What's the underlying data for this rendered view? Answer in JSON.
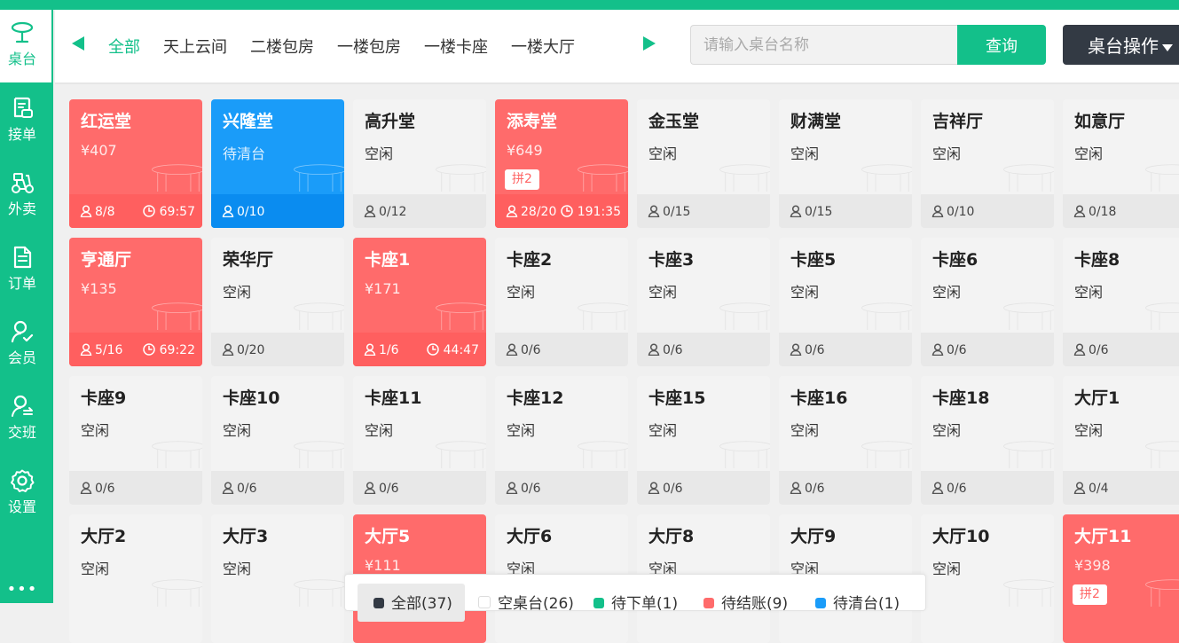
{
  "sidebar": {
    "items": [
      {
        "label": "桌台",
        "icon": "table-icon",
        "active": true
      },
      {
        "label": "接单",
        "icon": "receipt-icon"
      },
      {
        "label": "外卖",
        "icon": "scooter-icon"
      },
      {
        "label": "订单",
        "icon": "document-icon"
      },
      {
        "label": "会员",
        "icon": "member-icon"
      },
      {
        "label": "交班",
        "icon": "handover-icon"
      },
      {
        "label": "设置",
        "icon": "gear-icon"
      }
    ],
    "more": "•••"
  },
  "header": {
    "areas": [
      "全部",
      "天上云间",
      "二楼包房",
      "一楼包房",
      "一楼卡座",
      "一楼大厅"
    ],
    "active_area": "全部",
    "search_placeholder": "请输入桌台名称",
    "search_value": "",
    "query_label": "查询",
    "ops_label": "桌台操作"
  },
  "colors": {
    "brand": "#13c08a",
    "occupied": "#ff6b6b",
    "to_clean": "#1a9cf9",
    "idle": "#f3f3f3"
  },
  "tables": [
    {
      "name": "红运堂",
      "status": "¥407",
      "state": "red",
      "guests": "8/8",
      "time": "69:57"
    },
    {
      "name": "兴隆堂",
      "status": "待清台",
      "state": "blue",
      "guests": "0/10"
    },
    {
      "name": "高升堂",
      "status": "空闲",
      "state": "idle",
      "guests": "0/12"
    },
    {
      "name": "添寿堂",
      "status": "¥649",
      "state": "red",
      "badge": "拼2",
      "guests": "28/20",
      "time": "191:35"
    },
    {
      "name": "金玉堂",
      "status": "空闲",
      "state": "idle",
      "guests": "0/15"
    },
    {
      "name": "财满堂",
      "status": "空闲",
      "state": "idle",
      "guests": "0/15"
    },
    {
      "name": "吉祥厅",
      "status": "空闲",
      "state": "idle",
      "guests": "0/10"
    },
    {
      "name": "如意厅",
      "status": "空闲",
      "state": "idle",
      "guests": "0/18"
    },
    {
      "name": "亨通厅",
      "status": "¥135",
      "state": "red",
      "guests": "5/16",
      "time": "69:22"
    },
    {
      "name": "荣华厅",
      "status": "空闲",
      "state": "idle",
      "guests": "0/20"
    },
    {
      "name": "卡座1",
      "status": "¥171",
      "state": "red",
      "guests": "1/6",
      "time": "44:47"
    },
    {
      "name": "卡座2",
      "status": "空闲",
      "state": "idle",
      "guests": "0/6"
    },
    {
      "name": "卡座3",
      "status": "空闲",
      "state": "idle",
      "guests": "0/6"
    },
    {
      "name": "卡座5",
      "status": "空闲",
      "state": "idle",
      "guests": "0/6"
    },
    {
      "name": "卡座6",
      "status": "空闲",
      "state": "idle",
      "guests": "0/6"
    },
    {
      "name": "卡座8",
      "status": "空闲",
      "state": "idle",
      "guests": "0/6"
    },
    {
      "name": "卡座9",
      "status": "空闲",
      "state": "idle",
      "guests": "0/6"
    },
    {
      "name": "卡座10",
      "status": "空闲",
      "state": "idle",
      "guests": "0/6"
    },
    {
      "name": "卡座11",
      "status": "空闲",
      "state": "idle",
      "guests": "0/6"
    },
    {
      "name": "卡座12",
      "status": "空闲",
      "state": "idle",
      "guests": "0/6"
    },
    {
      "name": "卡座15",
      "status": "空闲",
      "state": "idle",
      "guests": "0/6"
    },
    {
      "name": "卡座16",
      "status": "空闲",
      "state": "idle",
      "guests": "0/6"
    },
    {
      "name": "卡座18",
      "status": "空闲",
      "state": "idle",
      "guests": "0/6"
    },
    {
      "name": "大厅1",
      "status": "空闲",
      "state": "idle",
      "guests": "0/4"
    },
    {
      "name": "大厅2",
      "status": "空闲",
      "state": "idle"
    },
    {
      "name": "大厅3",
      "status": "空闲",
      "state": "idle"
    },
    {
      "name": "大厅5",
      "status": "¥111",
      "state": "red"
    },
    {
      "name": "大厅6",
      "status": "空闲",
      "state": "idle"
    },
    {
      "name": "大厅8",
      "status": "空闲",
      "state": "idle"
    },
    {
      "name": "大厅9",
      "status": "空闲",
      "state": "idle"
    },
    {
      "name": "大厅10",
      "status": "空闲",
      "state": "idle"
    },
    {
      "name": "大厅11",
      "status": "¥398",
      "state": "red",
      "badge": "拼2"
    }
  ],
  "legend": [
    {
      "label": "全部(37)",
      "color": "#333a44"
    },
    {
      "label": "空桌台(26)",
      "color": "#ffffff"
    },
    {
      "label": "待下单(1)",
      "color": "#13c08a"
    },
    {
      "label": "待结账(9)",
      "color": "#ff6b6b"
    },
    {
      "label": "待清台(1)",
      "color": "#1a9cf9"
    }
  ]
}
